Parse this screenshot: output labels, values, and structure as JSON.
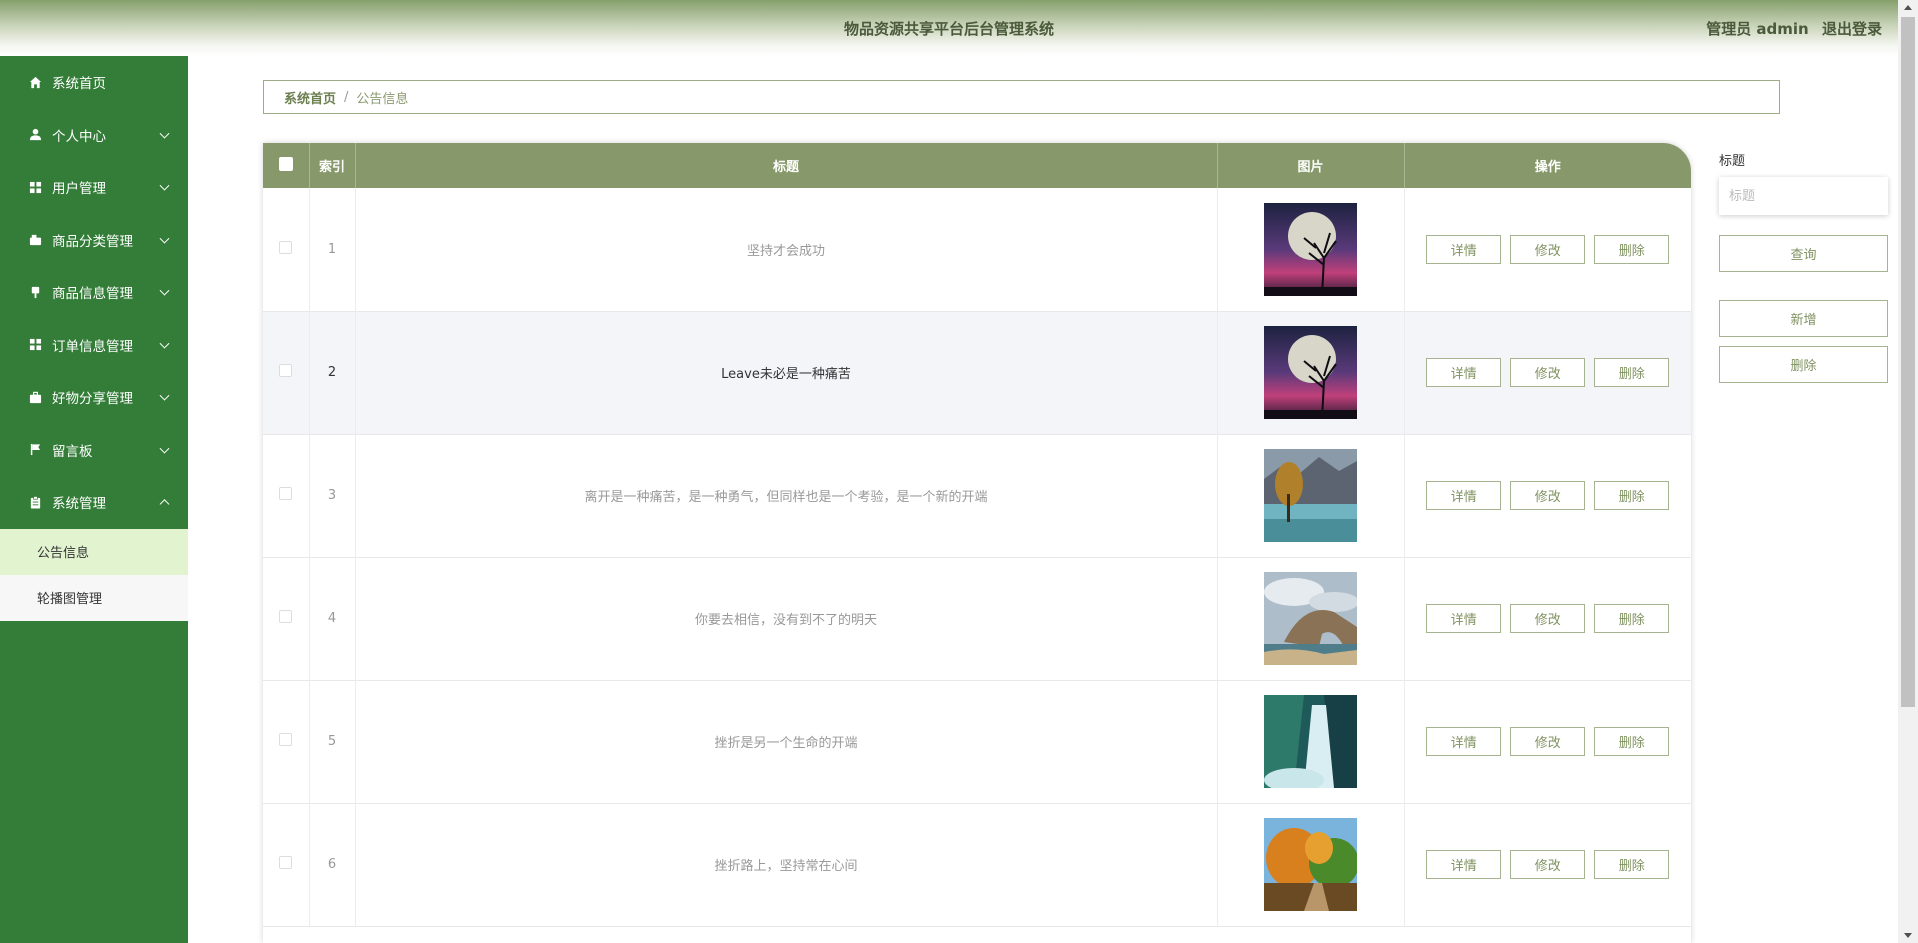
{
  "header": {
    "app_title": "物品资源共享平台后台管理系统",
    "user_label": "管理员 admin",
    "logout_label": "退出登录"
  },
  "sidebar": {
    "items": [
      {
        "label": "系统首页",
        "icon": "home-icon"
      },
      {
        "label": "个人中心",
        "icon": "user-icon"
      },
      {
        "label": "用户管理",
        "icon": "grid-icon"
      },
      {
        "label": "商品分类管理",
        "icon": "tag-icon"
      },
      {
        "label": "商品信息管理",
        "icon": "pin-icon"
      },
      {
        "label": "订单信息管理",
        "icon": "grid-icon"
      },
      {
        "label": "好物分享管理",
        "icon": "briefcase-icon"
      },
      {
        "label": "留言板",
        "icon": "flag-icon"
      },
      {
        "label": "系统管理",
        "icon": "clipboard-icon"
      }
    ],
    "sub_items": [
      {
        "label": "公告信息",
        "active": true
      },
      {
        "label": "轮播图管理",
        "active": false
      }
    ]
  },
  "breadcrumb": {
    "home": "系统首页",
    "separator": "/",
    "current": "公告信息"
  },
  "table": {
    "columns": {
      "index": "索引",
      "title": "标题",
      "image": "图片",
      "actions": "操作"
    },
    "action_labels": {
      "detail": "详情",
      "edit": "修改",
      "delete": "删除"
    },
    "rows": [
      {
        "index": "1",
        "title": "坚持才会成功",
        "image": "moon-tree-image"
      },
      {
        "index": "2",
        "title": "Leave未必是一种痛苦",
        "image": "moon-tree-image"
      },
      {
        "index": "3",
        "title": "离开是一种痛苦，是一种勇气，但同样也是一个考验，是一个新的开端",
        "image": "lake-tree-image"
      },
      {
        "index": "4",
        "title": "你要去相信，没有到不了的明天",
        "image": "rock-arch-image"
      },
      {
        "index": "5",
        "title": "挫折是另一个生命的开端",
        "image": "waterfall-image"
      },
      {
        "index": "6",
        "title": "挫折路上，坚持常在心间",
        "image": "autumn-trees-image"
      }
    ]
  },
  "search": {
    "label": "标题",
    "placeholder": "标题",
    "query_button": "查询",
    "add_button": "新增",
    "delete_button": "删除"
  },
  "colors": {
    "sidebar_bg": "#337d38",
    "table_header_bg": "#87996a",
    "active_sub_bg": "#e2f3d0",
    "button_border": "#a5b390",
    "button_text": "#7f9260"
  }
}
